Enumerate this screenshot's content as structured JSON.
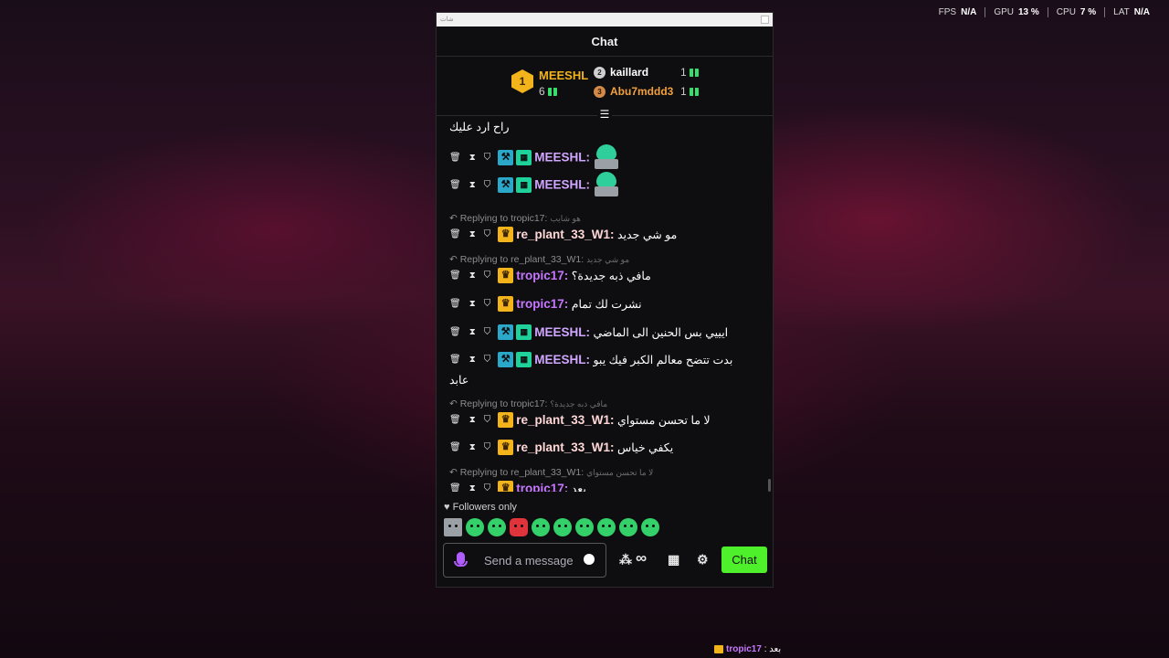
{
  "hud": [
    {
      "label": "FPS",
      "value": "N/A"
    },
    {
      "label": "GPU",
      "value": "13 %"
    },
    {
      "label": "CPU",
      "value": "7 %"
    },
    {
      "label": "LAT",
      "value": "N/A"
    }
  ],
  "window": {
    "titlebar": "شات"
  },
  "chat": {
    "title": "Chat",
    "leaderboard": {
      "first": {
        "rank": "1",
        "name": "MEESHL",
        "count": "6"
      },
      "second": {
        "rank": "2",
        "name": "kaillard",
        "count": "1"
      },
      "third": {
        "rank": "3",
        "name": "Abu7mddd3",
        "count": "1"
      }
    },
    "messages": {
      "m0": {
        "text": "راح ارد عليك"
      },
      "m1": {
        "user": "MEESHL:"
      },
      "m2": {
        "user": "MEESHL:"
      },
      "r3": {
        "label": "Replying to tropic17:",
        "orig": "هو شايب"
      },
      "m3": {
        "user": "re_plant_33_W1:",
        "text": "مو شي جديد"
      },
      "r4": {
        "label": "Replying to re_plant_33_W1:",
        "orig": "مو شي جديد"
      },
      "m4": {
        "user": "tropic17:",
        "text": "مافي ذبه جديدة؟"
      },
      "m5": {
        "user": "tropic17:",
        "text": "نشرت لك تمام"
      },
      "m6": {
        "user": "MEESHL:",
        "text": "ايييي بس الحنين الى الماضي"
      },
      "m7": {
        "user": "MEESHL:",
        "text": "بدت تتضح معالم الكبر فيك يبو",
        "cont": "عابد"
      },
      "r8": {
        "label": "Replying to tropic17:",
        "orig": "مافي ذبه جديدة؟"
      },
      "m8": {
        "user": "re_plant_33_W1:",
        "text": "لا ما تحسن مستواي"
      },
      "m9": {
        "user": "re_plant_33_W1:",
        "text": "يكفي خياس"
      },
      "r10": {
        "label": "Replying to re_plant_33_W1:",
        "orig": "لا ما تحسن مستواي"
      },
      "m10": {
        "user": "tropic17:",
        "text": "بعد"
      }
    },
    "followers_only": "Followers only",
    "input_placeholder": "Send a message",
    "chat_button": "Chat",
    "infinity": "∞"
  },
  "ticker": {
    "user": "tropic17",
    "text": ": بعد"
  },
  "colors": {
    "accent": "#4ef02b",
    "gold": "#f2b31b",
    "purple": "#c777ff",
    "mod_blue": "#2aa7c9"
  },
  "icons": [
    "trash-icon",
    "hourglass-icon",
    "shield-icon",
    "mod-sword-icon",
    "gift-icon",
    "crown-icon",
    "mic-icon",
    "smile-icon",
    "wallet-icon",
    "store-icon",
    "gear-icon",
    "heart-icon"
  ]
}
